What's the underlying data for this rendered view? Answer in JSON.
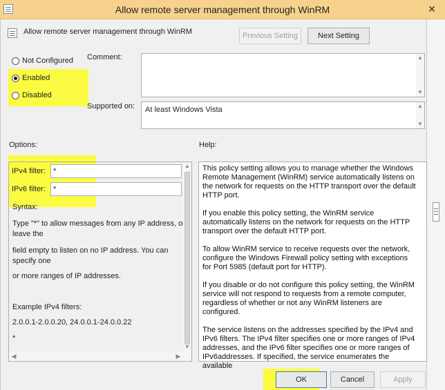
{
  "window": {
    "title": "Allow remote server management through WinRM",
    "close_glyph": "✕"
  },
  "header": {
    "title": "Allow remote server management through WinRM",
    "icon": "policy-icon"
  },
  "nav": {
    "previous_label": "Previous Setting",
    "next_label": "Next Setting"
  },
  "state": {
    "options": [
      {
        "label": "Not Configured",
        "checked": false
      },
      {
        "label": "Enabled",
        "checked": true
      },
      {
        "label": "Disabled",
        "checked": false
      }
    ]
  },
  "comment": {
    "label": "Comment:",
    "value": ""
  },
  "supported": {
    "label": "Supported on:",
    "value": "At least Windows Vista"
  },
  "options_panel": {
    "label": "Options:",
    "ipv4_label": "IPv4 filter:",
    "ipv4_value": "*",
    "ipv6_label": "IPv6 filter:",
    "ipv6_value": "*",
    "syntax": "Syntax:",
    "line1": "Type \"*\" to allow messages from any IP address, or leave the",
    "line2": "field empty to listen on no IP address. You can specify one",
    "line3": "or more ranges of IP addresses.",
    "example_heading": "Example IPv4 filters:",
    "example_value": "2.0.0.1-2.0.0.20, 24.0.0.1-24.0.0.22",
    "example_more": "*"
  },
  "help_panel": {
    "label": "Help:",
    "paragraphs": [
      "This policy setting allows you to manage whether the Windows Remote Management (WinRM) service automatically listens on the network for requests on the HTTP transport over the default HTTP port.",
      "If you enable this policy setting, the WinRM service automatically listens on the network for requests on the HTTP transport over the default HTTP port.",
      "To allow WinRM service to receive requests over the network, configure the Windows Firewall policy setting with exceptions for Port 5985 (default port for HTTP).",
      "If you disable or do not configure this policy setting, the WinRM service will not respond to requests from a remote computer, regardless of whether or not any WinRM listeners are configured.",
      "The service listens on the addresses specified by the IPv4 and IPv6 filters. The IPv4 filter specifies one or more ranges of IPv4 addresses, and the IPv6 filter specifies one or more ranges of IPv6addresses. If specified, the service enumerates the available"
    ]
  },
  "footer": {
    "ok_label": "OK",
    "cancel_label": "Cancel",
    "apply_label": "Apply"
  },
  "colors": {
    "titlebar": "#f7d28c",
    "highlight": "#ffff00",
    "dialog_bg": "#f0f0f0"
  }
}
